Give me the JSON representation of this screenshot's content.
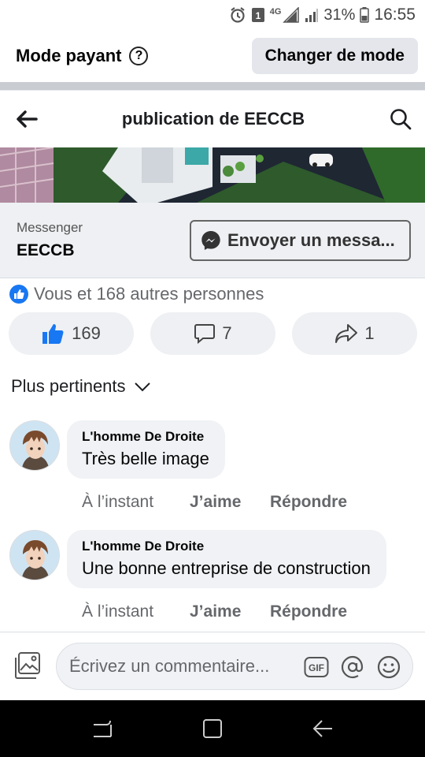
{
  "status_bar": {
    "network": "4G",
    "sim": "1",
    "battery": "31%",
    "time": "16:55"
  },
  "mode_bar": {
    "label": "Mode payant",
    "button": "Changer de mode"
  },
  "header": {
    "title": "publication de EECCB"
  },
  "messenger": {
    "label": "Messenger",
    "page_name": "EECCB",
    "send_button": "Envoyer un messa..."
  },
  "reactions": {
    "summary": "Vous et 168 autres personnes",
    "like_count": "169",
    "comment_count": "7",
    "share_count": "1"
  },
  "sort": {
    "label": "Plus pertinents"
  },
  "comments": [
    {
      "author": "L'homme De Droite",
      "text": "Très belle image",
      "time": "À l’instant",
      "like_label": "J’aime",
      "reply_label": "Répondre"
    },
    {
      "author": "L'homme De Droite",
      "text": "Une bonne entreprise de construction",
      "time": "À l’instant",
      "like_label": "J’aime",
      "reply_label": "Répondre"
    }
  ],
  "composer": {
    "placeholder": "Écrivez un commentaire..."
  },
  "colors": {
    "brand_blue": "#1877f2",
    "pill_bg": "#eef0f3",
    "bubble_bg": "#f0f2f5",
    "muted_text": "#65676b"
  }
}
